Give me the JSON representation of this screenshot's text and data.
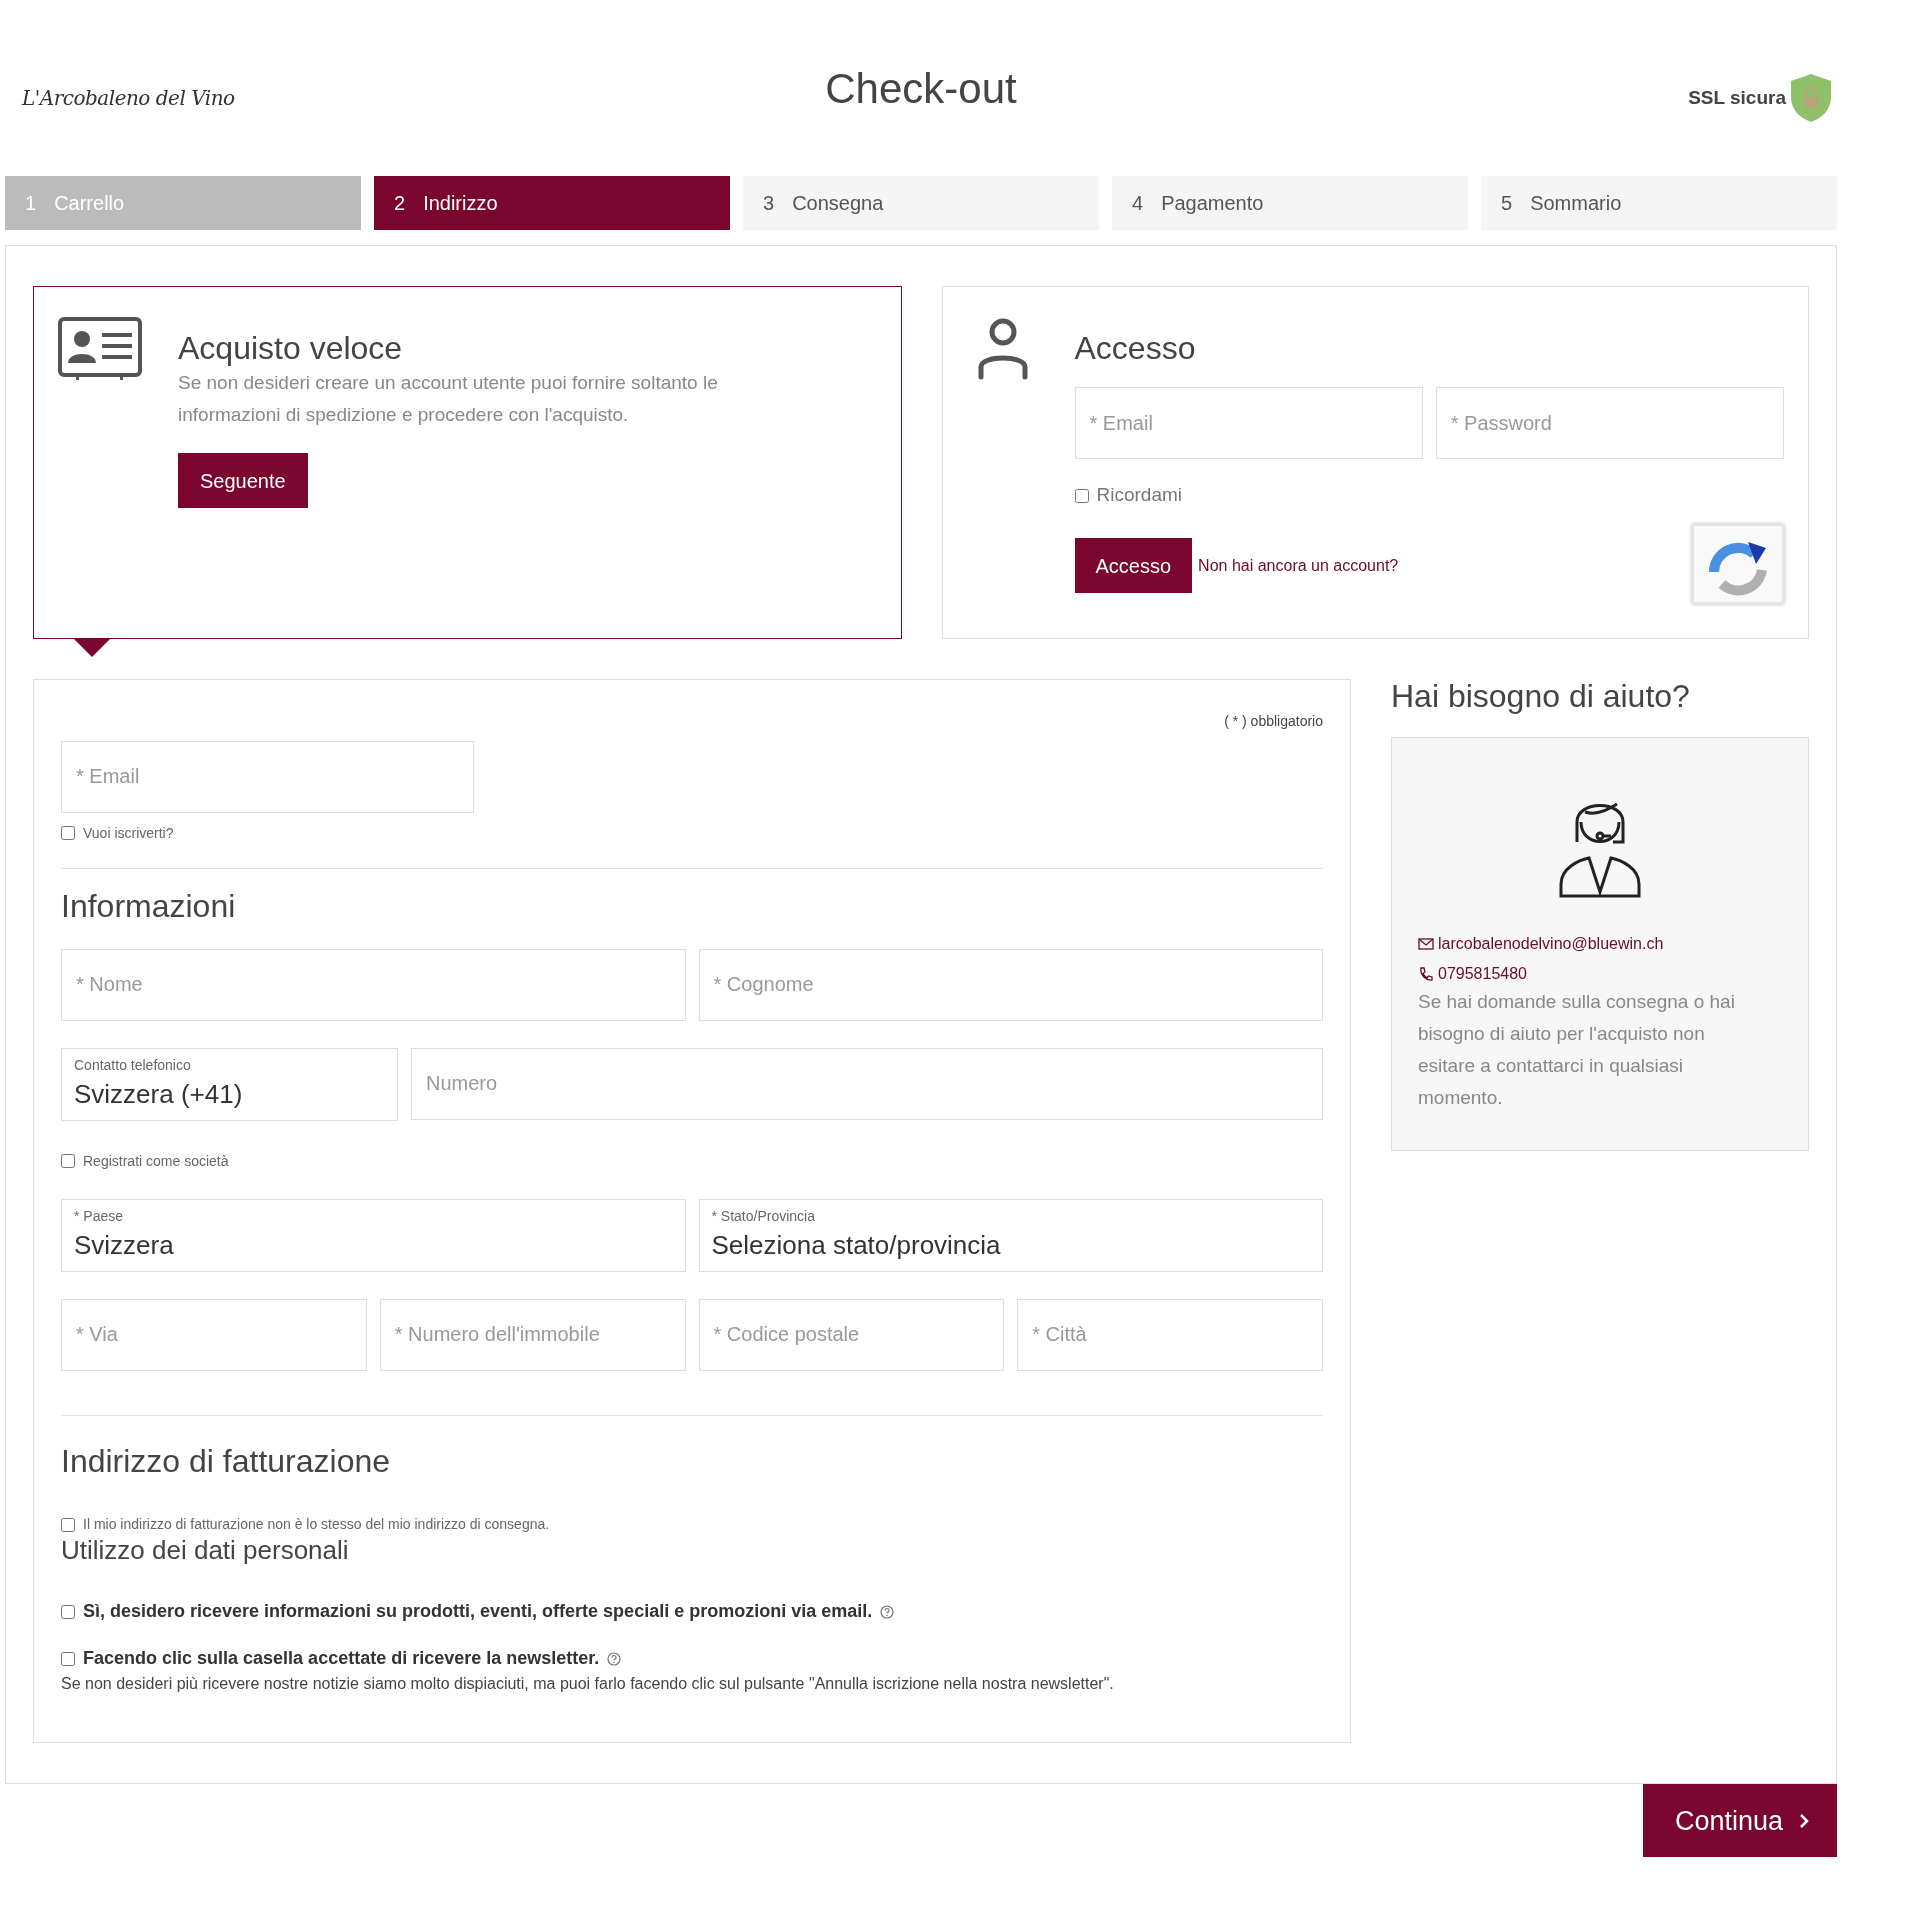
{
  "header": {
    "logo": "L'Arcobaleno del Vino",
    "title": "Check-out",
    "ssl_label": "SSL sicura"
  },
  "steps": [
    {
      "number": "1",
      "label": "Carrello",
      "selected": false,
      "completed": true
    },
    {
      "number": "2",
      "label": "Indirizzo",
      "selected": true,
      "completed": false
    },
    {
      "number": "3",
      "label": "Consegna",
      "selected": false,
      "completed": false
    },
    {
      "number": "4",
      "label": "Pagamento",
      "selected": false,
      "completed": false
    },
    {
      "number": "5",
      "label": "Sommario",
      "selected": false,
      "completed": false
    }
  ],
  "quick_purchase": {
    "title": "Acquisto veloce",
    "text": "Se non desideri creare un account utente puoi fornire soltanto le informazioni di spedizione e procedere con l'acquisto.",
    "button": "Seguente",
    "selected": true
  },
  "login": {
    "title": "Accesso",
    "email_placeholder": "* Email",
    "password_placeholder": "* Password",
    "remember": {
      "label": "Ricordami",
      "checked": false
    },
    "button": "Accesso",
    "register_link": "Non hai ancora un account?"
  },
  "form": {
    "required_note": "( * ) obbligatorio",
    "email_placeholder": "* Email",
    "subscribe": {
      "label": "Vuoi iscriverti?",
      "checked": false
    },
    "info_title": "Informazioni",
    "info_items": [
      {
        "kind": "row",
        "fields": [
          {
            "kind": "input",
            "placeholder": "* Nome"
          },
          {
            "kind": "input",
            "placeholder": "* Cognome"
          }
        ]
      },
      {
        "kind": "row",
        "fields": [
          {
            "kind": "prefix",
            "label": "Contatto telefonico",
            "value": "Svizzera (+41)"
          },
          {
            "kind": "input",
            "placeholder": "Numero"
          }
        ]
      },
      {
        "kind": "checkbox",
        "label": "Registrati come società",
        "checked": false
      },
      {
        "kind": "row",
        "fields": [
          {
            "kind": "select",
            "label": "* Paese",
            "value": "Svizzera"
          },
          {
            "kind": "select",
            "label": "* Stato/Provincia",
            "value": "Seleziona stato/provincia"
          }
        ]
      },
      {
        "kind": "row",
        "fields": [
          {
            "kind": "input",
            "placeholder": "* Via"
          },
          {
            "kind": "input",
            "placeholder": "* Numero dell'immobile"
          },
          {
            "kind": "input",
            "placeholder": "* Codice postale"
          },
          {
            "kind": "input",
            "placeholder": "* Città"
          }
        ]
      }
    ],
    "billing_title": "Indirizzo di fatturazione",
    "billing_checkbox": {
      "label": "Il mio indirizzo di fatturazione non è lo stesso del mio indirizzo di consegna.",
      "checked": false
    },
    "privacy_title": "Utilizzo dei dati personali",
    "consents": [
      {
        "label": "Sì, desidero ricevere informazioni su prodotti, eventi, offerte speciali e promozioni via email.",
        "checked": false
      },
      {
        "label": "Facendo clic sulla casella accettate di ricevere la newsletter.",
        "checked": false
      }
    ],
    "privacy_note": "Se non desideri più ricevere nostre notizie siamo molto dispiaciuti, ma puoi farlo facendo clic sul pulsante \"Annulla iscrizione nella nostra newsletter\"."
  },
  "help": {
    "title": "Hai bisogno di aiuto?",
    "email": "larcobalenodelvino@bluewin.ch",
    "phone": "0795815480",
    "text": "Se hai domande sulla consegna o hai bisogno di aiuto per l'acquisto non esitare a contattarci in qualsiasi momento."
  },
  "continue_button": "Continua"
}
